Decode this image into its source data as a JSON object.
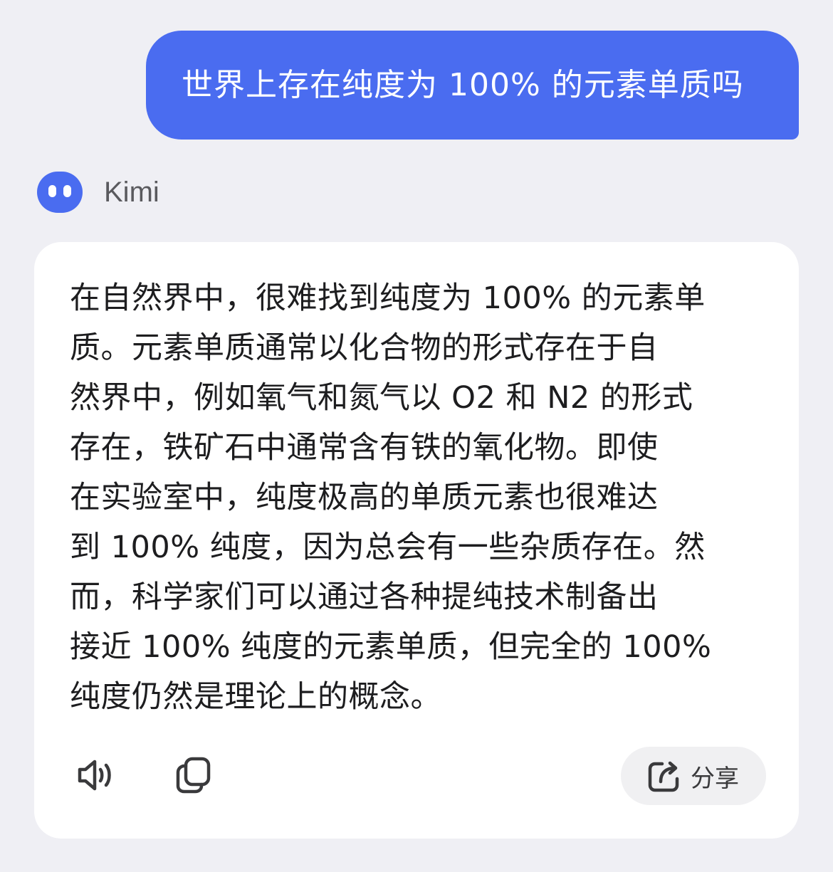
{
  "user_message": {
    "text": "世界上存在纯度为 100% 的元素单质吗"
  },
  "assistant": {
    "name": "Kimi",
    "avatar_icon": "kimi-logo-icon"
  },
  "answer": {
    "lines": [
      "在自然界中，很难找到纯度为 100% 的元素单",
      "质。元素单质通常以化合物的形式存在于自",
      "然界中，例如氧气和氮气以 O2 和 N2 的形式",
      "存在，铁矿石中通常含有铁的氧化物。即使",
      "在实验室中，纯度极高的单质元素也很难达",
      "到 100% 纯度，因为总会有一些杂质存在。然",
      "而，科学家们可以通过各种提纯技术制备出",
      "接近 100% 纯度的元素单质，但完全的 100%",
      "纯度仍然是理论上的概念。"
    ]
  },
  "actions": {
    "speaker_icon": "speaker-icon",
    "copy_icon": "copy-icon",
    "share_icon": "share-icon",
    "share_label": "分享"
  },
  "colors": {
    "accent": "#4a6cf0",
    "background": "#efeff4",
    "card": "#ffffff",
    "text": "#1d1d1f"
  }
}
